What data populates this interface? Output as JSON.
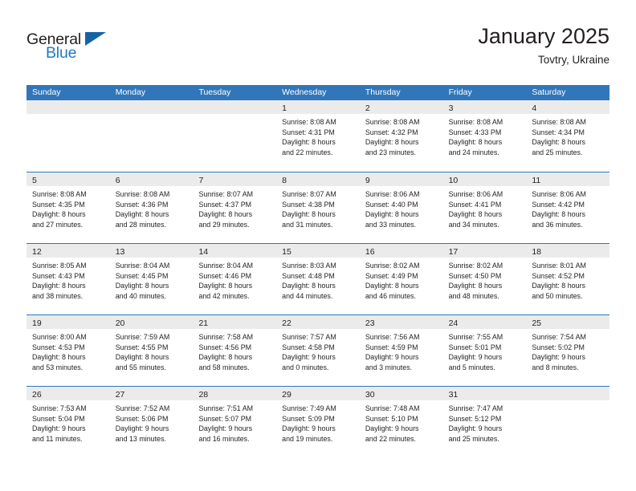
{
  "branding": {
    "logo_text_primary": "General",
    "logo_text_secondary": "Blue",
    "logo_icon": "triangle-flag-icon",
    "accent_color": "#3176b8",
    "logo_blue": "#1e7ac4"
  },
  "header": {
    "title": "January 2025",
    "subtitle": "Tovtry, Ukraine"
  },
  "calendar": {
    "weekday_headers": [
      "Sunday",
      "Monday",
      "Tuesday",
      "Wednesday",
      "Thursday",
      "Friday",
      "Saturday"
    ],
    "weeks": [
      [
        {
          "day": "",
          "lines": []
        },
        {
          "day": "",
          "lines": []
        },
        {
          "day": "",
          "lines": []
        },
        {
          "day": "1",
          "lines": [
            "Sunrise: 8:08 AM",
            "Sunset: 4:31 PM",
            "Daylight: 8 hours",
            "and 22 minutes."
          ]
        },
        {
          "day": "2",
          "lines": [
            "Sunrise: 8:08 AM",
            "Sunset: 4:32 PM",
            "Daylight: 8 hours",
            "and 23 minutes."
          ]
        },
        {
          "day": "3",
          "lines": [
            "Sunrise: 8:08 AM",
            "Sunset: 4:33 PM",
            "Daylight: 8 hours",
            "and 24 minutes."
          ]
        },
        {
          "day": "4",
          "lines": [
            "Sunrise: 8:08 AM",
            "Sunset: 4:34 PM",
            "Daylight: 8 hours",
            "and 25 minutes."
          ]
        }
      ],
      [
        {
          "day": "5",
          "lines": [
            "Sunrise: 8:08 AM",
            "Sunset: 4:35 PM",
            "Daylight: 8 hours",
            "and 27 minutes."
          ]
        },
        {
          "day": "6",
          "lines": [
            "Sunrise: 8:08 AM",
            "Sunset: 4:36 PM",
            "Daylight: 8 hours",
            "and 28 minutes."
          ]
        },
        {
          "day": "7",
          "lines": [
            "Sunrise: 8:07 AM",
            "Sunset: 4:37 PM",
            "Daylight: 8 hours",
            "and 29 minutes."
          ]
        },
        {
          "day": "8",
          "lines": [
            "Sunrise: 8:07 AM",
            "Sunset: 4:38 PM",
            "Daylight: 8 hours",
            "and 31 minutes."
          ]
        },
        {
          "day": "9",
          "lines": [
            "Sunrise: 8:06 AM",
            "Sunset: 4:40 PM",
            "Daylight: 8 hours",
            "and 33 minutes."
          ]
        },
        {
          "day": "10",
          "lines": [
            "Sunrise: 8:06 AM",
            "Sunset: 4:41 PM",
            "Daylight: 8 hours",
            "and 34 minutes."
          ]
        },
        {
          "day": "11",
          "lines": [
            "Sunrise: 8:06 AM",
            "Sunset: 4:42 PM",
            "Daylight: 8 hours",
            "and 36 minutes."
          ]
        }
      ],
      [
        {
          "day": "12",
          "lines": [
            "Sunrise: 8:05 AM",
            "Sunset: 4:43 PM",
            "Daylight: 8 hours",
            "and 38 minutes."
          ]
        },
        {
          "day": "13",
          "lines": [
            "Sunrise: 8:04 AM",
            "Sunset: 4:45 PM",
            "Daylight: 8 hours",
            "and 40 minutes."
          ]
        },
        {
          "day": "14",
          "lines": [
            "Sunrise: 8:04 AM",
            "Sunset: 4:46 PM",
            "Daylight: 8 hours",
            "and 42 minutes."
          ]
        },
        {
          "day": "15",
          "lines": [
            "Sunrise: 8:03 AM",
            "Sunset: 4:48 PM",
            "Daylight: 8 hours",
            "and 44 minutes."
          ]
        },
        {
          "day": "16",
          "lines": [
            "Sunrise: 8:02 AM",
            "Sunset: 4:49 PM",
            "Daylight: 8 hours",
            "and 46 minutes."
          ]
        },
        {
          "day": "17",
          "lines": [
            "Sunrise: 8:02 AM",
            "Sunset: 4:50 PM",
            "Daylight: 8 hours",
            "and 48 minutes."
          ]
        },
        {
          "day": "18",
          "lines": [
            "Sunrise: 8:01 AM",
            "Sunset: 4:52 PM",
            "Daylight: 8 hours",
            "and 50 minutes."
          ]
        }
      ],
      [
        {
          "day": "19",
          "lines": [
            "Sunrise: 8:00 AM",
            "Sunset: 4:53 PM",
            "Daylight: 8 hours",
            "and 53 minutes."
          ]
        },
        {
          "day": "20",
          "lines": [
            "Sunrise: 7:59 AM",
            "Sunset: 4:55 PM",
            "Daylight: 8 hours",
            "and 55 minutes."
          ]
        },
        {
          "day": "21",
          "lines": [
            "Sunrise: 7:58 AM",
            "Sunset: 4:56 PM",
            "Daylight: 8 hours",
            "and 58 minutes."
          ]
        },
        {
          "day": "22",
          "lines": [
            "Sunrise: 7:57 AM",
            "Sunset: 4:58 PM",
            "Daylight: 9 hours",
            "and 0 minutes."
          ]
        },
        {
          "day": "23",
          "lines": [
            "Sunrise: 7:56 AM",
            "Sunset: 4:59 PM",
            "Daylight: 9 hours",
            "and 3 minutes."
          ]
        },
        {
          "day": "24",
          "lines": [
            "Sunrise: 7:55 AM",
            "Sunset: 5:01 PM",
            "Daylight: 9 hours",
            "and 5 minutes."
          ]
        },
        {
          "day": "25",
          "lines": [
            "Sunrise: 7:54 AM",
            "Sunset: 5:02 PM",
            "Daylight: 9 hours",
            "and 8 minutes."
          ]
        }
      ],
      [
        {
          "day": "26",
          "lines": [
            "Sunrise: 7:53 AM",
            "Sunset: 5:04 PM",
            "Daylight: 9 hours",
            "and 11 minutes."
          ]
        },
        {
          "day": "27",
          "lines": [
            "Sunrise: 7:52 AM",
            "Sunset: 5:06 PM",
            "Daylight: 9 hours",
            "and 13 minutes."
          ]
        },
        {
          "day": "28",
          "lines": [
            "Sunrise: 7:51 AM",
            "Sunset: 5:07 PM",
            "Daylight: 9 hours",
            "and 16 minutes."
          ]
        },
        {
          "day": "29",
          "lines": [
            "Sunrise: 7:49 AM",
            "Sunset: 5:09 PM",
            "Daylight: 9 hours",
            "and 19 minutes."
          ]
        },
        {
          "day": "30",
          "lines": [
            "Sunrise: 7:48 AM",
            "Sunset: 5:10 PM",
            "Daylight: 9 hours",
            "and 22 minutes."
          ]
        },
        {
          "day": "31",
          "lines": [
            "Sunrise: 7:47 AM",
            "Sunset: 5:12 PM",
            "Daylight: 9 hours",
            "and 25 minutes."
          ]
        },
        {
          "day": "",
          "lines": []
        }
      ]
    ]
  }
}
